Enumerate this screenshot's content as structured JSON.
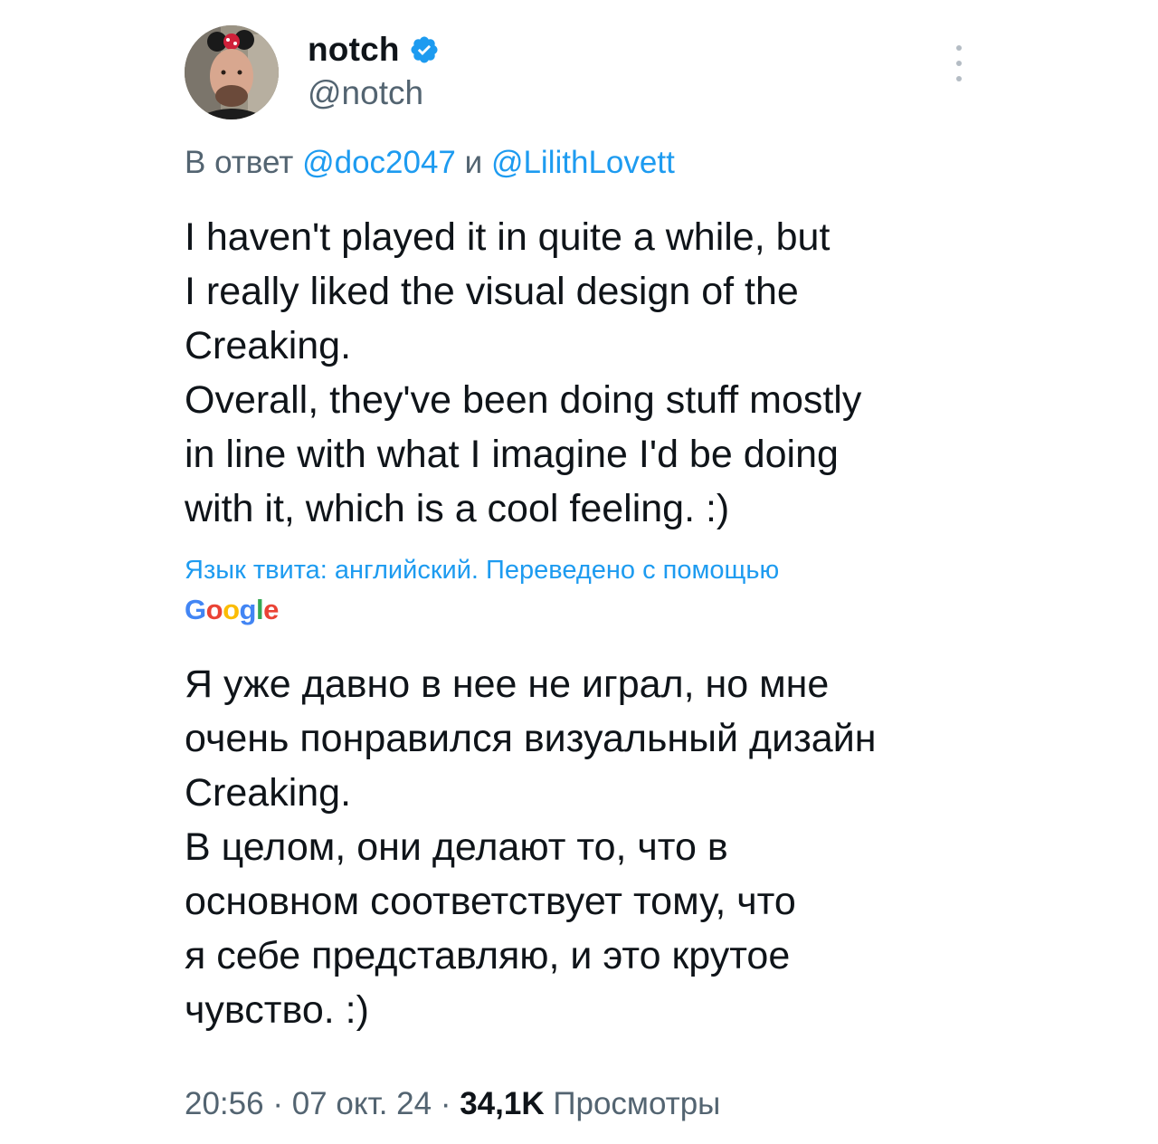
{
  "author": {
    "display_name": "notch",
    "handle": "@notch",
    "verified": true
  },
  "reply_context": {
    "prefix": "В ответ",
    "mention_1": "@doc2047",
    "conjunction": "и",
    "mention_2": "@LilithLovett"
  },
  "tweet": {
    "text": "I haven't played it in quite a while, but\nI really liked the visual design of the\nCreaking.\nOverall, they've been doing stuff mostly\nin line with what I imagine I'd be doing\nwith it, which is a cool feeling. :)"
  },
  "translation": {
    "note": "Язык твита: английский. Переведено с помощью",
    "provider": "Google",
    "text": "Я уже давно в нее не играл, но мне\nочень понравился визуальный дизайн\nCreaking.\nВ целом, они делают то, что в\nосновном соответствует тому, что\nя себе представляю, и это крутое\nчувство. :)"
  },
  "meta": {
    "time": "20:56",
    "date": "07 окт. 24",
    "separator": "·",
    "views_count": "34,1K",
    "views_label": "Просмотры"
  },
  "colors": {
    "link": "#1d9bf0",
    "secondary_text": "#536471",
    "primary_text": "#0f1419"
  },
  "icons": {
    "verified": "verified-badge-icon",
    "more": "more-vertical-icon"
  }
}
